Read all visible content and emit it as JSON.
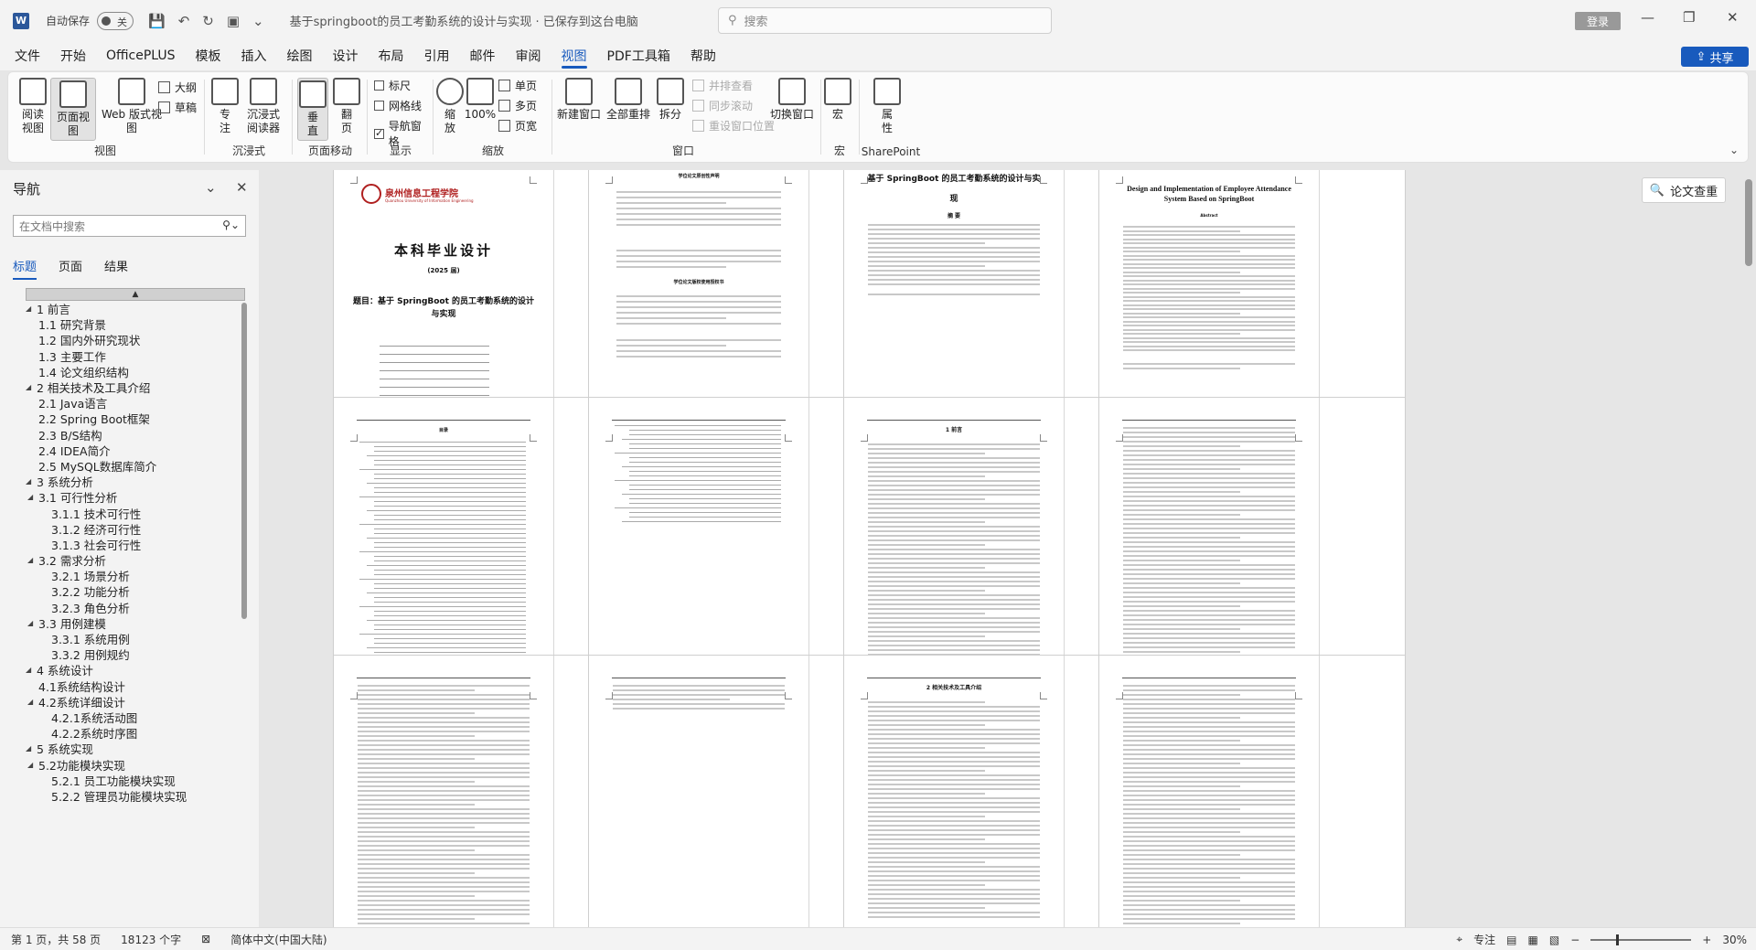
{
  "titlebar": {
    "app_icon": "W",
    "autosave_label": "自动保存",
    "autosave_state": "关",
    "doc_title": "基于springboot的员工考勤系统的设计与实现 · 已保存到这台电脑",
    "search_placeholder": "搜索",
    "login_label": "登录"
  },
  "menu": {
    "items": [
      "文件",
      "开始",
      "OfficePLUS",
      "模板",
      "插入",
      "绘图",
      "设计",
      "布局",
      "引用",
      "邮件",
      "审阅",
      "视图",
      "PDF工具箱",
      "帮助"
    ],
    "active": "视图",
    "share_label": "共享"
  },
  "ribbon": {
    "groups": {
      "view": "视图",
      "immersive": "沉浸式",
      "page_move": "页面移动",
      "show": "显示",
      "zoom": "缩放",
      "window": "窗口",
      "macro": "宏",
      "sharepoint": "SharePoint"
    },
    "buttons": {
      "read_mode": "阅读\n视图",
      "print_layout": "页面视图",
      "web_layout": "Web 版式视图",
      "outline": "大纲",
      "draft": "草稿",
      "focus": "专\n注",
      "immersive_reader": "沉浸式\n阅读器",
      "vertical": "垂\n直",
      "side_to_side": "翻\n页",
      "ruler": "标尺",
      "gridlines": "网格线",
      "nav_pane": "导航窗格",
      "zoom": "缩\n放",
      "zoom_100": "100%",
      "one_page": "单页",
      "multi_page": "多页",
      "page_width": "页宽",
      "new_window": "新建窗口",
      "arrange_all": "全部重排",
      "split": "拆分",
      "side_by_side": "并排查看",
      "sync_scroll": "同步滚动",
      "reset_window": "重设窗口位置",
      "switch_window": "切换窗口",
      "macros": "宏",
      "properties": "属\n性"
    },
    "checks": {
      "ruler": false,
      "gridlines": false,
      "nav_pane": true
    }
  },
  "nav": {
    "title": "导航",
    "search_placeholder": "在文档中搜索",
    "tabs": [
      "标题",
      "页面",
      "结果"
    ],
    "items": [
      {
        "level": 1,
        "text": "1 前言",
        "caret": "◢"
      },
      {
        "level": 2,
        "text": "1.1 研究背景",
        "caret": ""
      },
      {
        "level": 2,
        "text": "1.2 国内外研究现状",
        "caret": ""
      },
      {
        "level": 2,
        "text": "1.3 主要工作",
        "caret": ""
      },
      {
        "level": 2,
        "text": "1.4 论文组织结构",
        "caret": ""
      },
      {
        "level": 1,
        "text": "2 相关技术及工具介绍",
        "caret": "◢"
      },
      {
        "level": 2,
        "text": "2.1 Java语言",
        "caret": ""
      },
      {
        "level": 2,
        "text": "2.2 Spring Boot框架",
        "caret": ""
      },
      {
        "level": 2,
        "text": "2.3 B/S结构",
        "caret": ""
      },
      {
        "level": 2,
        "text": "2.4 IDEA简介",
        "caret": ""
      },
      {
        "level": 2,
        "text": "2.5 MySQL数据库简介",
        "caret": ""
      },
      {
        "level": 1,
        "text": "3   系统分析",
        "caret": "◢"
      },
      {
        "level": 2,
        "text": "3.1 可行性分析",
        "caret": "◢"
      },
      {
        "level": 3,
        "text": "3.1.1 技术可行性",
        "caret": ""
      },
      {
        "level": 3,
        "text": "3.1.2 经济可行性",
        "caret": ""
      },
      {
        "level": 3,
        "text": "3.1.3 社会可行性",
        "caret": ""
      },
      {
        "level": 2,
        "text": "3.2 需求分析",
        "caret": "◢"
      },
      {
        "level": 3,
        "text": "3.2.1 场景分析",
        "caret": ""
      },
      {
        "level": 3,
        "text": "3.2.2 功能分析",
        "caret": ""
      },
      {
        "level": 3,
        "text": "3.2.3 角色分析",
        "caret": ""
      },
      {
        "level": 2,
        "text": "3.3 用例建模",
        "caret": "◢"
      },
      {
        "level": 3,
        "text": "3.3.1 系统用例",
        "caret": ""
      },
      {
        "level": 3,
        "text": "3.3.2 用例规约",
        "caret": ""
      },
      {
        "level": 1,
        "text": "4 系统设计",
        "caret": "◢"
      },
      {
        "level": 2,
        "text": "4.1系统结构设计",
        "caret": ""
      },
      {
        "level": 2,
        "text": "4.2系统详细设计",
        "caret": "◢"
      },
      {
        "level": 3,
        "text": "4.2.1系统活动图",
        "caret": ""
      },
      {
        "level": 3,
        "text": "4.2.2系统时序图",
        "caret": ""
      },
      {
        "level": 1,
        "text": "5 系统实现",
        "caret": "◢"
      },
      {
        "level": 2,
        "text": "5.2功能模块实现",
        "caret": "◢"
      },
      {
        "level": 3,
        "text": "5.2.1 员工功能模块实现",
        "caret": ""
      },
      {
        "level": 3,
        "text": "5.2.2 管理员功能模块实现",
        "caret": ""
      }
    ]
  },
  "pages": {
    "cover_title": "本科毕业设计",
    "cover_year": "(2025 届)",
    "cover_topic": "题目：基于 SpringBoot 的员工考勤系统的设计与实现",
    "cover_school": "泉州信息工程学院",
    "cover_school_en": "Quanzhou University of Information Engineering",
    "p2_title": "学位论文原创性声明",
    "p2_title2": "学位论文版权使用授权书",
    "p3_title": "基于 SpringBoot 的员工考勤系统的设计与实现",
    "p3_abstract": "摘 要",
    "p4_title": "Design and Implementation of Employee Attendance System Based on SpringBoot",
    "p4_abstract": "Abstract",
    "p5_title": "目录",
    "p7_title": "1  前言",
    "p11_title": "2  相关技术及工具介绍"
  },
  "paper_check": "论文查重",
  "status": {
    "page": "第 1 页，共 58 页",
    "words": "18123 个字",
    "language": "简体中文(中国大陆)",
    "focus": "专注",
    "zoom": "30%"
  }
}
